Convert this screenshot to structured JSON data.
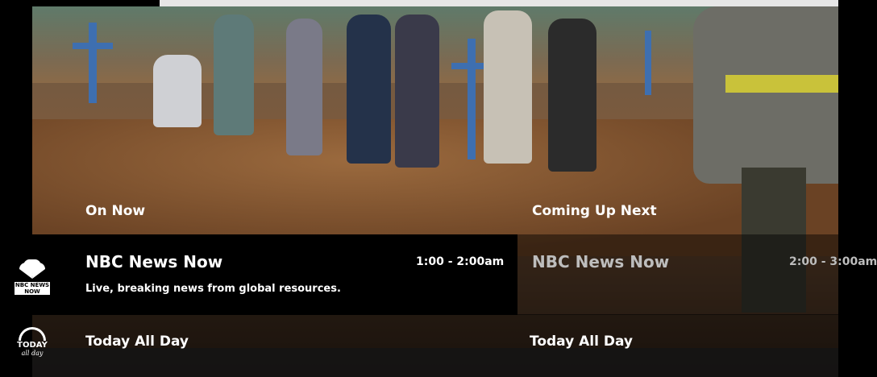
{
  "sections": {
    "on_now_label": "On Now",
    "coming_up_label": "Coming Up Next"
  },
  "channels": [
    {
      "logo_text": "NBC NEWS NOW",
      "current": {
        "title": "NBC News Now",
        "time": "1:00 - 2:00am",
        "description": "Live, breaking news from global resources."
      },
      "next": {
        "title": "NBC News Now",
        "time": "2:00 - 3:00am"
      }
    },
    {
      "logo_text_1": "TODAY",
      "logo_text_2": "all day",
      "current": {
        "title": "Today All Day"
      },
      "next": {
        "title": "Today All Day"
      }
    }
  ]
}
